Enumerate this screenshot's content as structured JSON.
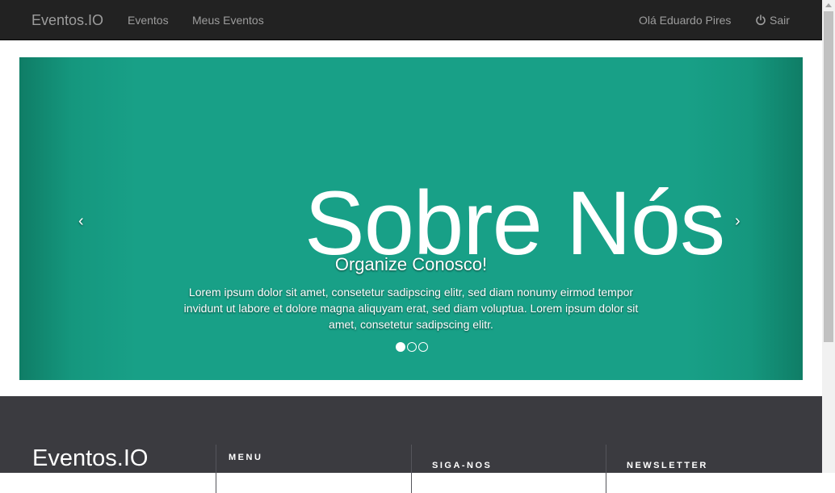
{
  "navbar": {
    "brand": "Eventos.IO",
    "links": [
      "Eventos",
      "Meus Eventos"
    ],
    "greeting": "Olá Eduardo Pires",
    "logout_label": "Sair",
    "logout_icon": "power-icon"
  },
  "carousel": {
    "title": "Sobre Nós",
    "caption_title": "Organize Conosco!",
    "caption_text": "Lorem ipsum dolor sit amet, consetetur sadipscing elitr, sed diam nonumy eirmod tempor invidunt ut labore et dolore magna aliquyam erat, sed diam voluptua. Lorem ipsum dolor sit amet, consetetur sadipscing elitr.",
    "prev_icon": "‹",
    "next_icon": "›",
    "slide_count": 3,
    "active_slide": 1,
    "background_color": "#18a087"
  },
  "footer": {
    "brand": "Eventos.IO",
    "menu_heading": "MENU",
    "follow_heading": "SIGA-NOS",
    "newsletter_heading": "NEWSLETTER",
    "background_color": "#3b3b40"
  }
}
